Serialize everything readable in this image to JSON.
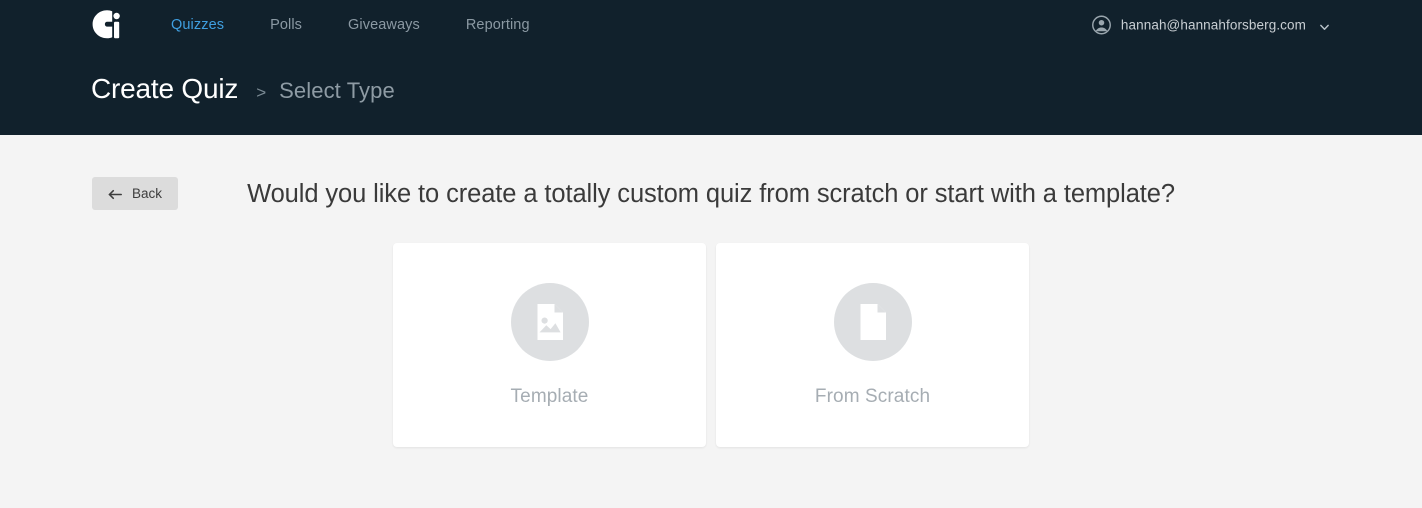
{
  "theme": {
    "header_bg": "#11212c",
    "page_bg": "#f4f4f4",
    "accent": "#3f9fe0",
    "card_bg": "#ffffff",
    "muted_text": "#a6adb3"
  },
  "header": {
    "logo_name": "interact-logo-icon",
    "nav": [
      {
        "label": "Quizzes",
        "active": true
      },
      {
        "label": "Polls",
        "active": false
      },
      {
        "label": "Giveaways",
        "active": false
      },
      {
        "label": "Reporting",
        "active": false
      }
    ],
    "account": {
      "avatar_icon": "account-circle-icon",
      "email": "hannah@hannahforsberg.com",
      "caret_icon": "chevron-down-icon"
    },
    "breadcrumb": {
      "title": "Create Quiz",
      "separator": ">",
      "current": "Select Type"
    }
  },
  "main": {
    "back_button": {
      "icon": "arrow-left-icon",
      "label": "Back"
    },
    "prompt": "Would you like to create a totally custom quiz from scratch or start with a template?",
    "choices": [
      {
        "label": "Template",
        "icon": "document-image-icon"
      },
      {
        "label": "From Scratch",
        "icon": "blank-document-icon"
      }
    ]
  }
}
